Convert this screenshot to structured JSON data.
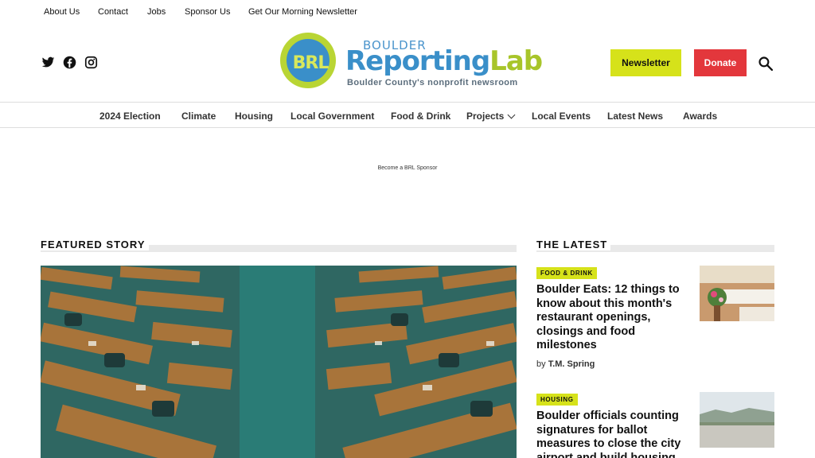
{
  "utility_nav": [
    "About Us",
    "Contact",
    "Jobs",
    "Sponsor Us",
    "Get Our Morning Newsletter"
  ],
  "logo": {
    "badge": "BRL",
    "top": "BOULDER",
    "main_a": "Reporting",
    "main_b": "Lab",
    "tagline": "Boulder County's nonprofit newsroom"
  },
  "social": [
    "twitter-icon",
    "facebook-icon",
    "instagram-icon"
  ],
  "buttons": {
    "newsletter": "Newsletter",
    "donate": "Donate"
  },
  "main_nav": [
    "2024 Election",
    "Climate",
    "Housing",
    "Local Government",
    "Food & Drink",
    "Projects",
    "Local Events",
    "Latest News",
    "Awards"
  ],
  "ad_label": "Become a BRL Sponsor",
  "featured": {
    "title": "FEATURED STORY"
  },
  "latest": {
    "title": "THE LATEST",
    "stories": [
      {
        "tag": "FOOD & DRINK",
        "headline": "Boulder Eats: 12 things to know about this month's restaurant openings, closings and food milestones",
        "by": "by",
        "author": "T.M. Spring"
      },
      {
        "tag": "HOUSING",
        "headline": "Boulder officials counting signatures for ballot measures to close the city airport and build housing"
      }
    ]
  },
  "colors": {
    "accent_yellow": "#d6e21a",
    "donate_red": "#e3373c",
    "brand_blue": "#3a8fc9",
    "brand_green": "#a8c52a"
  }
}
